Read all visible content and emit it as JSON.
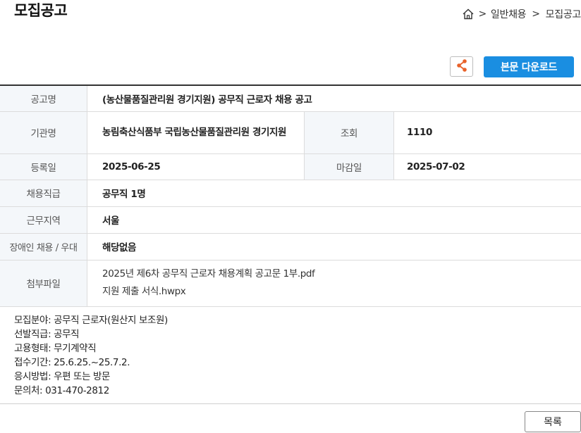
{
  "page_title": "모집공고",
  "breadcrumb": {
    "items": [
      "일반채용",
      "모집공고"
    ],
    "separator": ">"
  },
  "actions": {
    "download_label": "본문 다운로드",
    "share_icon": "share-icon"
  },
  "colors": {
    "accent": "#1a8ee1",
    "share_icon": "#e8622a",
    "header_bg": "#f4f7fa"
  },
  "posting": {
    "title_label": "공고명",
    "title": "(농산물품질관리원 경기지원) 공무직 근로자 채용 공고",
    "agency_label": "기관명",
    "agency": "농림축산식품부 국립농산물품질관리원 경기지원",
    "views_label": "조회",
    "views": "1110",
    "reg_date_label": "등록일",
    "reg_date": "2025-06-25",
    "deadline_label": "마감일",
    "deadline": "2025-07-02",
    "grade_label": "채용직급",
    "grade": "공무직 1명",
    "region_label": "근무지역",
    "region": "서울",
    "disability_label": "장애인 채용 / 우대",
    "disability": "해당없음",
    "attachments_label": "첨부파일",
    "attachments": [
      "2025년 제6차 공무직 근로자 채용계획 공고문 1부.pdf",
      "지원 제출 서식.hwpx"
    ]
  },
  "description": [
    "모집분야: 공무직 근로자(원산지 보조원)",
    "선발직급: 공무직",
    "고용형태: 무기계약직",
    "접수기간: 25.6.25.~25.7.2.",
    "응시방법: 우편 또는 방문",
    "문의처: 031-470-2812"
  ],
  "list_button_label": "목록"
}
